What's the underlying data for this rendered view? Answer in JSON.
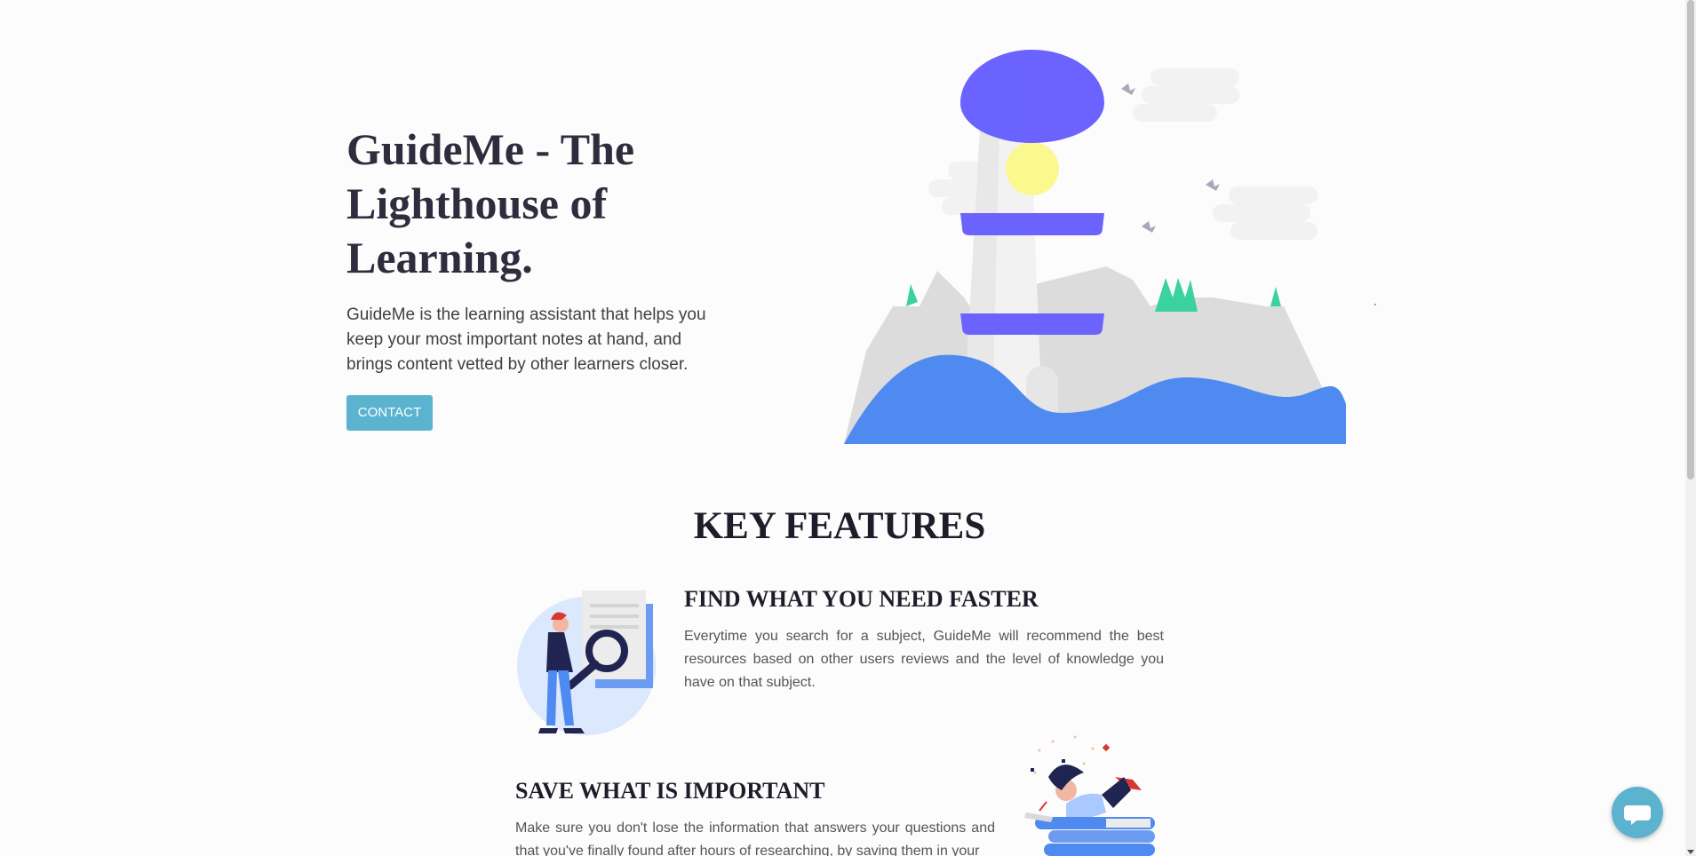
{
  "hero": {
    "title": "GuideMe - The Lighthouse of Learning.",
    "description": "GuideMe is the learning assistant that helps you keep your most important notes at hand, and brings content vetted by other learners closer.",
    "contact_label": "CONTACT"
  },
  "features": {
    "heading": "KEY FEATURES",
    "items": [
      {
        "title": "FIND WHAT YOU NEED FASTER",
        "description": "Everytime you search for a subject, GuideMe will recommend the best resources based on other users reviews and the level of knowledge you have on that subject.",
        "icon": "search-illustration-icon"
      },
      {
        "title": "SAVE WHAT IS IMPORTANT",
        "description": "Make sure you don't lose the information that answers your questions and that you've finally found after hours of researching, by saving them in your",
        "icon": "reading-illustration-icon"
      }
    ]
  },
  "chat": {
    "icon": "chat-bubble-icon"
  },
  "colors": {
    "accent": "#5bb3cf",
    "lighthouse_top": "#6c63ff",
    "water": "#4e8af0",
    "trees": "#3ad29f",
    "light": "#fbf88f"
  }
}
